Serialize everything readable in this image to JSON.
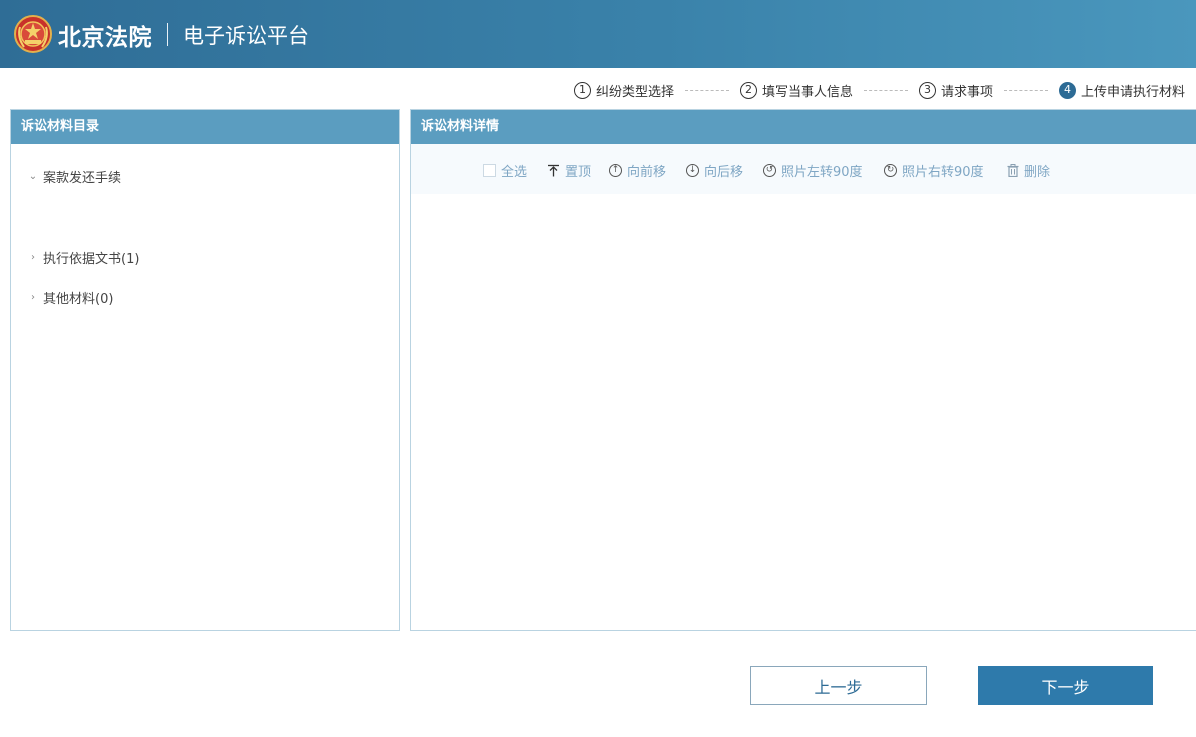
{
  "header": {
    "court_name": "北京法院",
    "platform_name": "电子诉讼平台"
  },
  "steps": [
    {
      "num": "1",
      "label": "纠纷类型选择",
      "active": false
    },
    {
      "num": "2",
      "label": "填写当事人信息",
      "active": false
    },
    {
      "num": "3",
      "label": "请求事项",
      "active": false
    },
    {
      "num": "4",
      "label": "上传申请执行材料",
      "active": true
    }
  ],
  "left_panel": {
    "title": "诉讼材料目录",
    "items": [
      {
        "label": "案款发还手续",
        "expanded": true,
        "icon": "chevron-down-icon"
      },
      {
        "label": "执行依据文书(1)",
        "expanded": false,
        "icon": "chevron-right-icon"
      },
      {
        "label": "其他材料(0)",
        "expanded": false,
        "icon": "chevron-right-icon"
      }
    ]
  },
  "right_panel": {
    "title": "诉讼材料详情",
    "toolbar": {
      "select_all": "全选",
      "pin_top": "置顶",
      "move_up": "向前移",
      "move_down": "向后移",
      "rotate_left": "照片左转90度",
      "rotate_right": "照片右转90度",
      "delete": "删除"
    }
  },
  "buttons": {
    "prev": "上一步",
    "next": "下一步"
  },
  "colors": {
    "header": "#3a82aa",
    "panel_head": "#5b9dc0",
    "primary_button": "#2e7aab",
    "toolbar_text": "#7fa6c4"
  }
}
